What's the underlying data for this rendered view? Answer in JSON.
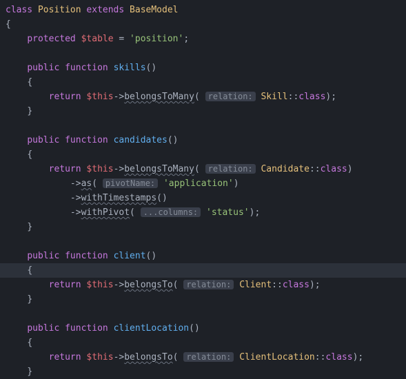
{
  "tokens": {
    "class_kw": "class",
    "class_name": "Position",
    "extends_kw": "extends",
    "base_class": "BaseModel",
    "protected_kw": "protected",
    "table_var": "$table",
    "table_value": "'position'",
    "public_kw": "public",
    "function_kw": "function",
    "return_kw": "return",
    "this_var": "$this",
    "fn_skills": "skills",
    "fn_candidates": "candidates",
    "fn_client": "client",
    "fn_clientLocation": "clientLocation",
    "m_belongsToMany": "belongsToMany",
    "m_belongsTo": "belongsTo",
    "m_as": "as",
    "m_withTimestamps": "withTimestamps",
    "m_withPivot": "withPivot",
    "hint_relation": "relation:",
    "hint_pivotName": "pivotName:",
    "hint_columns": "...columns:",
    "cls_Skill": "Skill",
    "cls_Candidate": "Candidate",
    "cls_Client": "Client",
    "cls_ClientLocation": "ClientLocation",
    "scope_class": "class",
    "str_application": "'application'",
    "str_status": "'status'",
    "brace_open": "{",
    "brace_close": "}",
    "paren_open": "(",
    "paren_close": ")",
    "arrow": "->",
    "eq": " = ",
    "semi": ";",
    "dcolon": "::"
  }
}
